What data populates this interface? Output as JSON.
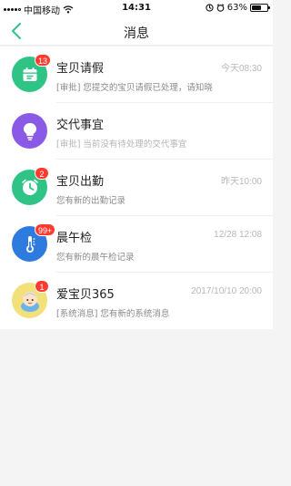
{
  "status_bar": {
    "carrier": "中国移动",
    "time": "14:31",
    "battery_percent": "63%",
    "battery_level": 0.63,
    "icons": [
      "signal-icon",
      "wifi-icon",
      "location-lock-icon",
      "alarm-icon",
      "battery-icon"
    ]
  },
  "nav": {
    "title": "消息",
    "back_icon": "chevron-left-icon",
    "accent_color": "#2fc486"
  },
  "messages": [
    {
      "title": "宝贝请假",
      "time": "今天08:30",
      "preview": "[审批] 您提交的宝贝请假已处理，请知晓",
      "badge": "13",
      "icon": "calendar-leave-icon",
      "icon_color": "#2fc486"
    },
    {
      "title": "交代事宜",
      "time": "",
      "preview": "[审批] 当前没有待处理的交代事宜",
      "badge": "",
      "icon": "lightbulb-icon",
      "icon_color": "#8a5ae6"
    },
    {
      "title": "宝贝出勤",
      "time": "昨天10:00",
      "preview": "您有新的出勤记录",
      "badge": "2",
      "icon": "clock-icon",
      "icon_color": "#2fc486"
    },
    {
      "title": "晨午检",
      "time": "12/28 12:08",
      "preview": "您有新的晨午检记录",
      "badge": "99+",
      "icon": "thermometer-icon",
      "icon_color": "#2e7be0"
    },
    {
      "title": "爱宝贝365",
      "time": "2017/10/10 20:00",
      "preview": "[系统消息] 您有新的系统消息",
      "badge": "1",
      "icon": "baby-mascot-icon",
      "icon_color": "#f2e07a"
    }
  ]
}
